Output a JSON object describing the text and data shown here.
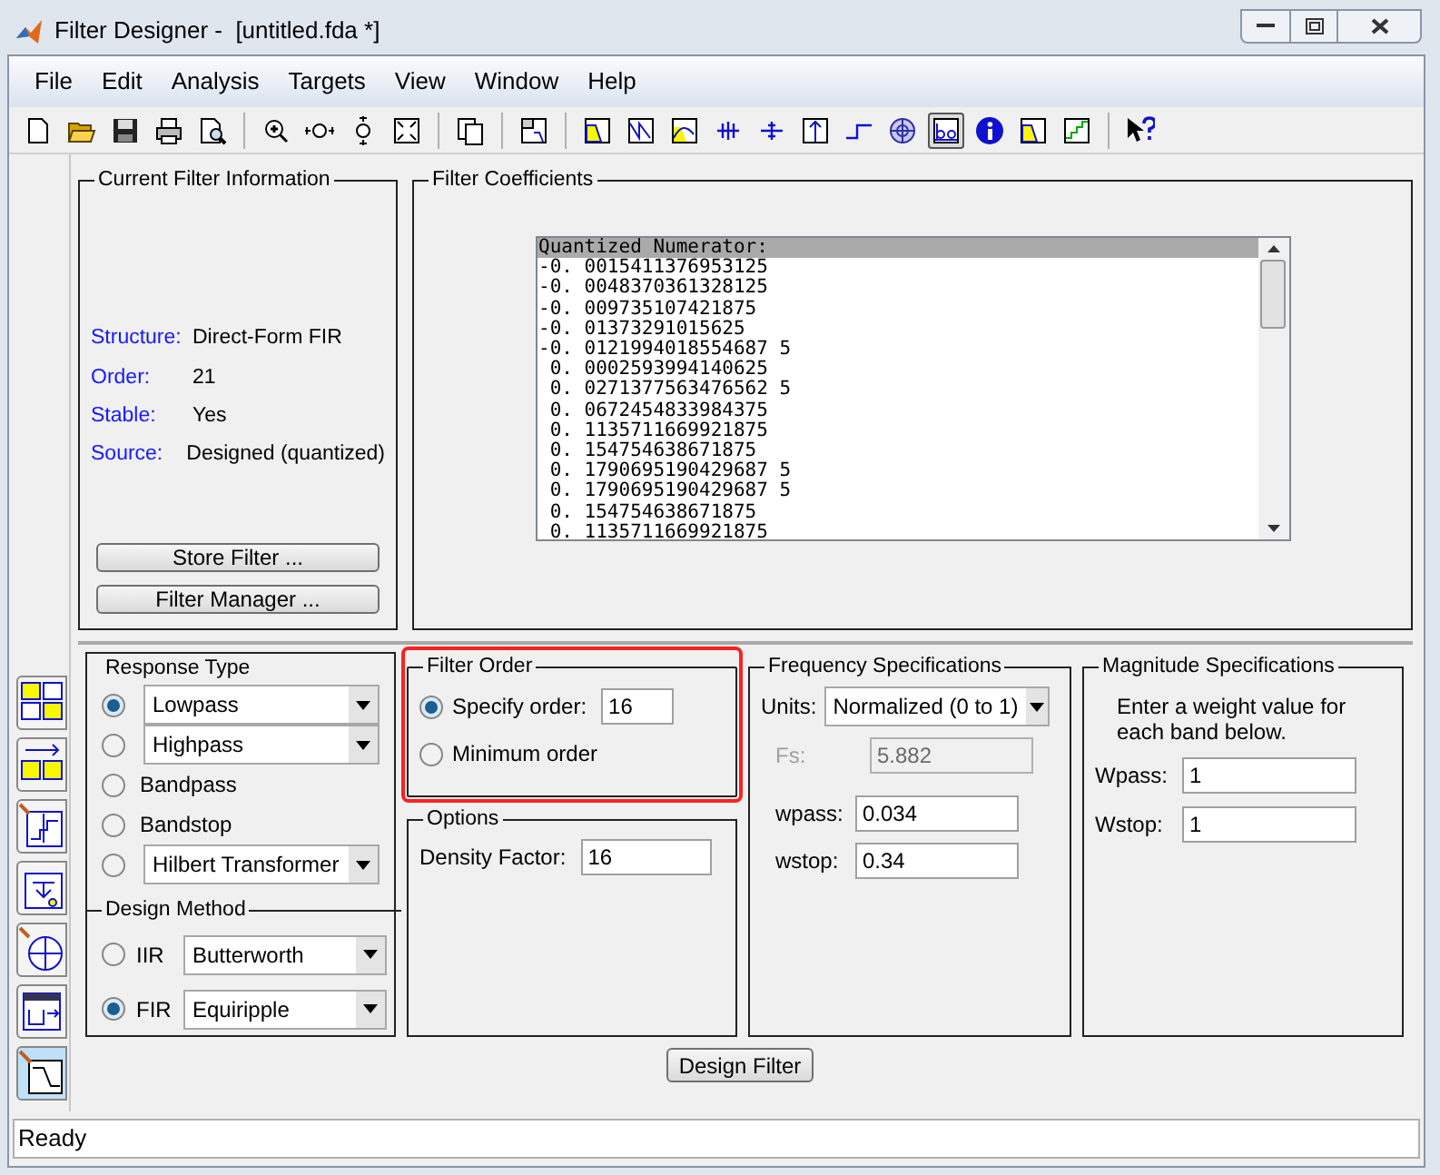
{
  "window": {
    "title": "Filter Designer -  [untitled.fda *]"
  },
  "menu": [
    "File",
    "Edit",
    "Analysis",
    "Targets",
    "View",
    "Window",
    "Help"
  ],
  "toolbar": [
    {
      "kind": "new",
      "selected": false
    },
    {
      "kind": "open",
      "selected": false
    },
    {
      "kind": "save",
      "selected": false
    },
    {
      "kind": "print",
      "selected": false
    },
    {
      "kind": "preview",
      "selected": false
    },
    {
      "kind": "separator"
    },
    {
      "kind": "zoom-in",
      "selected": false
    },
    {
      "kind": "zoom-x",
      "selected": false
    },
    {
      "kind": "zoom-y",
      "selected": false
    },
    {
      "kind": "full-view",
      "selected": false
    },
    {
      "kind": "separator"
    },
    {
      "kind": "windows",
      "selected": false
    },
    {
      "kind": "separator"
    },
    {
      "kind": "layout",
      "selected": false
    },
    {
      "kind": "separator"
    },
    {
      "kind": "magnitude",
      "selected": false
    },
    {
      "kind": "phase",
      "selected": false
    },
    {
      "kind": "mag-phase",
      "selected": false
    },
    {
      "kind": "group-delay",
      "selected": false
    },
    {
      "kind": "phase-delay",
      "selected": false
    },
    {
      "kind": "impulse",
      "selected": false
    },
    {
      "kind": "step",
      "selected": false
    },
    {
      "kind": "pole-zero",
      "selected": false
    },
    {
      "kind": "coefficients",
      "selected": true
    },
    {
      "kind": "info",
      "selected": false
    },
    {
      "kind": "magnitude",
      "selected": false
    },
    {
      "kind": "round-off",
      "selected": false
    },
    {
      "kind": "separator"
    },
    {
      "kind": "whats-this",
      "selected": false
    }
  ],
  "side_tools": [
    {
      "kind": "transform",
      "selected": false
    },
    {
      "kind": "convert",
      "selected": false
    },
    {
      "kind": "quantize",
      "selected": false
    },
    {
      "kind": "realize",
      "selected": false
    },
    {
      "kind": "pole-zero",
      "selected": false
    },
    {
      "kind": "import",
      "selected": false
    },
    {
      "kind": "design",
      "selected": true
    }
  ],
  "current_filter_info": {
    "title": "Current Filter Information",
    "rows": [
      {
        "label": "Structure:",
        "value": "Direct-Form FIR"
      },
      {
        "label": "Order:",
        "value": "21"
      },
      {
        "label": "Stable:",
        "value": "Yes"
      },
      {
        "label": "Source:",
        "value": "Designed (quantized)"
      }
    ],
    "buttons": [
      "Store Filter ...",
      "Filter Manager ..."
    ]
  },
  "filter_coefficients": {
    "title": "Filter Coefficients",
    "header": "Quantized Numerator:",
    "values": [
      "-0. 0015411376953125",
      "-0. 0048370361328125",
      "-0. 009735107421875",
      "-0. 01373291015625",
      "-0. 0121994018554687 5",
      " 0. 0002593994140625",
      " 0. 0271377563476562 5",
      " 0. 0672454833984375",
      " 0. 1135711669921875",
      " 0. 154754638671875",
      " 0. 1790695190429687 5",
      " 0. 1790695190429687 5",
      " 0. 154754638671875",
      " 0. 1135711669921875"
    ]
  },
  "response_type": {
    "title": "Response Type",
    "options": [
      {
        "kind": "dropdown",
        "label": "Lowpass",
        "selected": true
      },
      {
        "kind": "dropdown",
        "label": "Highpass",
        "selected": false
      },
      {
        "kind": "plain",
        "label": "Bandpass",
        "selected": false
      },
      {
        "kind": "plain",
        "label": "Bandstop",
        "selected": false
      },
      {
        "kind": "dropdown",
        "label": "Hilbert Transformer",
        "selected": false
      }
    ]
  },
  "design_method": {
    "title": "Design Method",
    "options": [
      {
        "label": "IIR",
        "value": "Butterworth",
        "selected": false
      },
      {
        "label": "FIR",
        "value": "Equiripple",
        "selected": true
      }
    ]
  },
  "filter_order": {
    "title": "Filter Order",
    "highlighted": true,
    "options": [
      {
        "kind": "input",
        "label": "Specify order:",
        "value": "16",
        "selected": true
      },
      {
        "kind": "plain",
        "label": "Minimum order",
        "selected": false
      }
    ]
  },
  "options": {
    "title": "Options",
    "fields": [
      {
        "label": "Density Factor:",
        "value": "16"
      }
    ]
  },
  "frequency_specifications": {
    "title": "Frequency Specifications",
    "units": {
      "label": "Units:",
      "value": "Normalized (0 to 1)"
    },
    "fields": [
      {
        "label": "Fs:",
        "value": "5.882",
        "disabled": true
      },
      {
        "label": "wpass:",
        "value": "0.034",
        "disabled": false
      },
      {
        "label": "wstop:",
        "value": "0.34",
        "disabled": false
      }
    ]
  },
  "magnitude_specifications": {
    "title": "Magnitude Specifications",
    "note": "Enter a weight value for each band below.",
    "fields": [
      {
        "label": "Wpass:",
        "value": "1"
      },
      {
        "label": "Wstop:",
        "value": "1"
      }
    ]
  },
  "design_button": "Design Filter",
  "status_bar": "Ready"
}
